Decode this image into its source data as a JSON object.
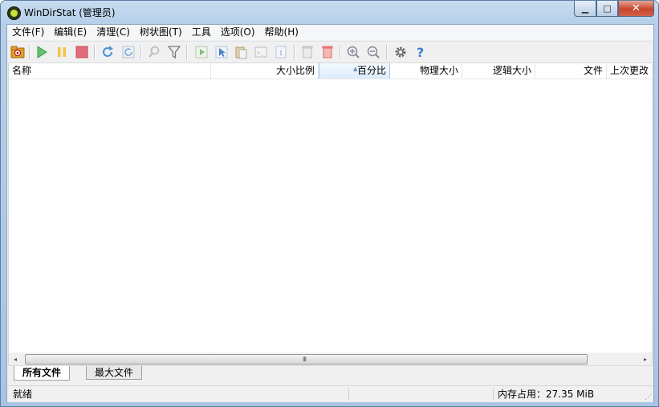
{
  "window": {
    "title": "WinDirStat (管理员)",
    "caption": {
      "minimize": "▁",
      "maximize": "□",
      "close": "✕"
    }
  },
  "menu": [
    "文件(F)",
    "编辑(E)",
    "清理(C)",
    "树状图(T)",
    "工具",
    "选项(O)",
    "帮助(H)"
  ],
  "toolbar": {
    "icons": [
      "open-drive-icon",
      "play-icon",
      "pause-icon",
      "stop-icon",
      "refresh-icon",
      "refresh-selected-icon",
      "search-icon",
      "filter-icon",
      "run-icon",
      "select-icon",
      "copy-path-icon",
      "command-prompt-icon",
      "properties-icon",
      "recycle-icon",
      "delete-icon",
      "zoom-in-icon",
      "zoom-out-icon",
      "settings-icon",
      "help-icon"
    ]
  },
  "columns": [
    {
      "label": "名称"
    },
    {
      "label": "大小比例"
    },
    {
      "label": "百分比"
    },
    {
      "label": "物理大小"
    },
    {
      "label": "逻辑大小"
    },
    {
      "label": "文件"
    },
    {
      "label": "上次更改"
    }
  ],
  "sorted_column": "百分比",
  "scrollbar": {
    "left": "◂",
    "right": "▸",
    "grip": "III"
  },
  "tabs": [
    {
      "label": "所有文件",
      "active": true
    },
    {
      "label": "最大文件",
      "active": false
    }
  ],
  "status": {
    "ready": "就绪",
    "memory": "内存占用：27.35 MiB"
  },
  "colors": {
    "title_bar": "#b6cfe9",
    "close_button": "#c7462c",
    "sorted_header": "#dcecfc"
  }
}
